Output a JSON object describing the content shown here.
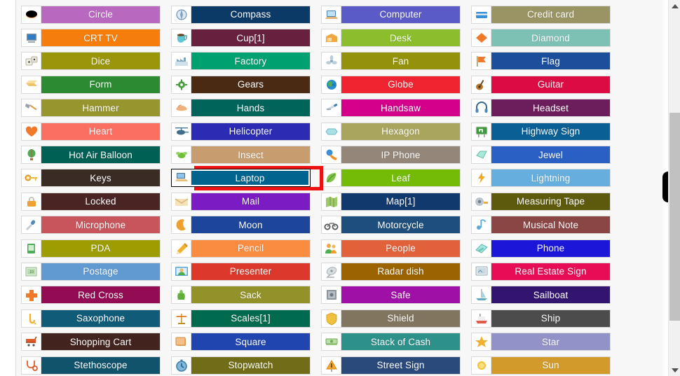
{
  "window": {
    "background": "#f7f7f7",
    "highlight_color": "#ee1111"
  },
  "scrollbar": {
    "up_arrow": "▲",
    "down_arrow": "▼",
    "orientation": "vertical"
  },
  "grid": {
    "columns": 4,
    "rows": 16,
    "selected_item": "Laptop",
    "items": [
      {
        "label": "Circle",
        "color": "#b868bf",
        "icon": "circle-icon"
      },
      {
        "label": "Compass",
        "color": "#0c3a66",
        "icon": "compass-icon"
      },
      {
        "label": "Computer",
        "color": "#5b5bc8",
        "icon": "computer-icon"
      },
      {
        "label": "Credit card",
        "color": "#9a9363",
        "icon": "credit-card-icon"
      },
      {
        "label": "CRT TV",
        "color": "#f57d0b",
        "icon": "crt-tv-icon"
      },
      {
        "label": "Cup[1]",
        "color": "#68203f",
        "icon": "cup-icon"
      },
      {
        "label": "Desk",
        "color": "#8bbd2c",
        "icon": "desk-icon"
      },
      {
        "label": "Diamond",
        "color": "#7dc1b4",
        "icon": "diamond-icon"
      },
      {
        "label": "Dice",
        "color": "#9a960c",
        "icon": "dice-icon"
      },
      {
        "label": "Factory",
        "color": "#00a171",
        "icon": "factory-icon"
      },
      {
        "label": "Fan",
        "color": "#93920a",
        "icon": "fan-icon"
      },
      {
        "label": "Flag",
        "color": "#1b4f9c",
        "icon": "flag-icon"
      },
      {
        "label": "Form",
        "color": "#2c8a32",
        "icon": "form-icon"
      },
      {
        "label": "Gears",
        "color": "#4b2a14",
        "icon": "gears-icon"
      },
      {
        "label": "Globe",
        "color": "#f02431",
        "icon": "globe-icon"
      },
      {
        "label": "Guitar",
        "color": "#dc0b44",
        "icon": "guitar-icon"
      },
      {
        "label": "Hammer",
        "color": "#97952d",
        "icon": "hammer-icon"
      },
      {
        "label": "Hands",
        "color": "#00645b",
        "icon": "hands-icon"
      },
      {
        "label": "Handsaw",
        "color": "#d4008c",
        "icon": "handsaw-icon"
      },
      {
        "label": "Headset",
        "color": "#6c1e5c",
        "icon": "headset-icon"
      },
      {
        "label": "Heart",
        "color": "#fb6f63",
        "icon": "heart-icon"
      },
      {
        "label": "Helicopter",
        "color": "#2b2bb4",
        "icon": "helicopter-icon"
      },
      {
        "label": "Hexagon",
        "color": "#a9a55e",
        "icon": "hexagon-icon"
      },
      {
        "label": "Highway Sign",
        "color": "#0a5f95",
        "icon": "highway-sign-icon"
      },
      {
        "label": "Hot Air Balloon",
        "color": "#006054",
        "icon": "hot-air-balloon-icon"
      },
      {
        "label": "Insect",
        "color": "#c79d6f",
        "icon": "insect-icon"
      },
      {
        "label": "IP Phone",
        "color": "#948779",
        "icon": "ip-phone-icon"
      },
      {
        "label": "Jewel",
        "color": "#2a5fc4",
        "icon": "jewel-icon"
      },
      {
        "label": "Keys",
        "color": "#3b2b25",
        "icon": "keys-icon"
      },
      {
        "label": "Laptop",
        "color": "#00648f",
        "icon": "laptop-icon"
      },
      {
        "label": "Leaf",
        "color": "#74bb08",
        "icon": "leaf-icon"
      },
      {
        "label": "Lightning",
        "color": "#66aedd",
        "icon": "lightning-icon"
      },
      {
        "label": "Locked",
        "color": "#4a2423",
        "icon": "locked-icon"
      },
      {
        "label": "Mail",
        "color": "#7a1bc4",
        "icon": "mail-icon"
      },
      {
        "label": "Map[1]",
        "color": "#11396e",
        "icon": "map-icon"
      },
      {
        "label": "Measuring Tape",
        "color": "#5e5a0d",
        "icon": "measuring-tape-icon"
      },
      {
        "label": "Microphone",
        "color": "#c9555c",
        "icon": "microphone-icon"
      },
      {
        "label": "Moon",
        "color": "#1d459a",
        "icon": "moon-icon"
      },
      {
        "label": "Motorcycle",
        "color": "#1e4f7c",
        "icon": "motorcycle-icon"
      },
      {
        "label": "Musical Note",
        "color": "#8a4545",
        "icon": "musical-note-icon"
      },
      {
        "label": "PDA",
        "color": "#9d9c00",
        "icon": "pda-icon"
      },
      {
        "label": "Pencil",
        "color": "#fa8c42",
        "icon": "pencil-icon"
      },
      {
        "label": "People",
        "color": "#e1623a",
        "icon": "people-icon"
      },
      {
        "label": "Phone",
        "color": "#1b16d8",
        "icon": "phone-icon"
      },
      {
        "label": "Postage",
        "color": "#609ad1",
        "icon": "postage-icon"
      },
      {
        "label": "Presenter",
        "color": "#dc392c",
        "icon": "presenter-icon"
      },
      {
        "label": "Radar dish",
        "color": "#9c6400",
        "icon": "radar-dish-icon"
      },
      {
        "label": "Real Estate Sign",
        "color": "#e60c55",
        "icon": "real-estate-sign-icon"
      },
      {
        "label": "Red Cross",
        "color": "#930b52",
        "icon": "red-cross-icon"
      },
      {
        "label": "Sack",
        "color": "#93912a",
        "icon": "sack-icon"
      },
      {
        "label": "Safe",
        "color": "#9f10a6",
        "icon": "safe-icon"
      },
      {
        "label": "Sailboat",
        "color": "#331570",
        "icon": "sailboat-icon"
      },
      {
        "label": "Saxophone",
        "color": "#0f5b78",
        "icon": "saxophone-icon"
      },
      {
        "label": "Scales[1]",
        "color": "#006a4e",
        "icon": "scales-icon"
      },
      {
        "label": "Shield",
        "color": "#81755f",
        "icon": "shield-icon"
      },
      {
        "label": "Ship",
        "color": "#4c4c4c",
        "icon": "ship-icon"
      },
      {
        "label": "Shopping Cart",
        "color": "#42231d",
        "icon": "shopping-cart-icon"
      },
      {
        "label": "Square",
        "color": "#2045ae",
        "icon": "square-icon"
      },
      {
        "label": "Stack of Cash",
        "color": "#2d9089",
        "icon": "stack-of-cash-icon"
      },
      {
        "label": "Star",
        "color": "#9292c8",
        "icon": "star-icon"
      },
      {
        "label": "Stethoscope",
        "color": "#10536b",
        "icon": "stethoscope-icon"
      },
      {
        "label": "Stopwatch",
        "color": "#716c17",
        "icon": "stopwatch-icon"
      },
      {
        "label": "Street Sign",
        "color": "#2b4a7c",
        "icon": "street-sign-icon"
      },
      {
        "label": "Sun",
        "color": "#d29a2b",
        "icon": "sun-icon"
      }
    ]
  }
}
